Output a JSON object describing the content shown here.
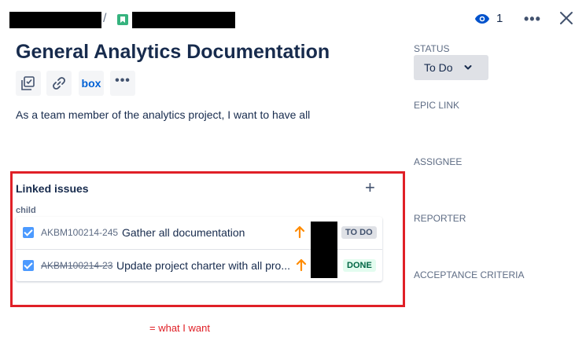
{
  "header": {
    "breadcrumb_separator": "/",
    "watch_count": "1",
    "icons": [
      "story-icon",
      "eye-icon",
      "more-icon",
      "close-icon"
    ]
  },
  "issue": {
    "title": "General Analytics Documentation",
    "description": "As a team member of the analytics project, I want to have all",
    "toolbar": {
      "box_label": "box",
      "icons": [
        "checklist-icon",
        "link-icon",
        "box-icon",
        "more-icon"
      ]
    }
  },
  "linked_issues": {
    "heading": "Linked issues",
    "add_symbol": "+",
    "relation": "child",
    "items": [
      {
        "key": "AKBM100214-245",
        "summary": "Gather all documentation",
        "status": "TO DO",
        "resolved": false
      },
      {
        "key": "AKBM100214-23",
        "summary": "Update project charter with all pro...",
        "status": "DONE",
        "resolved": true
      }
    ]
  },
  "annotation": "= what I want",
  "sidebar": {
    "status_label": "STATUS",
    "status_value": "To Do",
    "epic_link_label": "EPIC LINK",
    "assignee_label": "ASSIGNEE",
    "reporter_label": "REPORTER",
    "acceptance_label": "ACCEPTANCE CRITERIA"
  },
  "colors": {
    "priority_arrow": "#ff8b00",
    "highlight_frame": "#e02027",
    "checkbox": "#4c9aff",
    "story": "#36b37e"
  }
}
